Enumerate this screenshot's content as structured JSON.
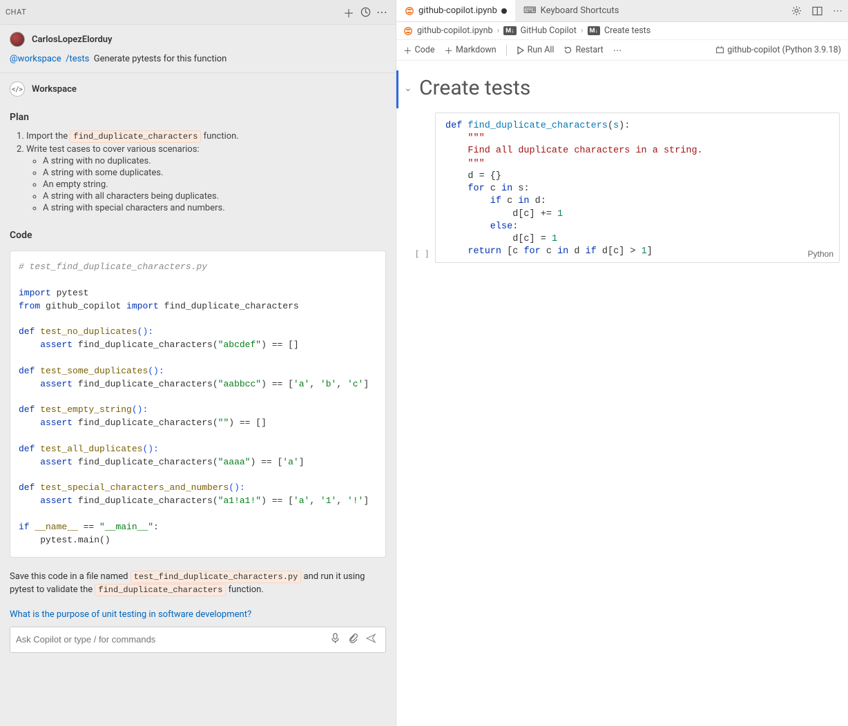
{
  "chat": {
    "header_title": "CHAT",
    "new_icon": "+",
    "history_icon": "history",
    "more_icon": "…",
    "username": "CarlosLopezElorduy",
    "mention": "@workspace",
    "slash": "/tests",
    "request_text": "Generate pytests for this function",
    "workspace_label": "Workspace",
    "plan_heading": "Plan",
    "plan_item1_prefix": "Import the ",
    "plan_item1_code": "find_duplicate_characters",
    "plan_item1_suffix": " function.",
    "plan_item2": "Write test cases to cover various scenarios:",
    "plan_sub": [
      "A string with no duplicates.",
      "A string with some duplicates.",
      "An empty string.",
      "A string with all characters being duplicates.",
      "A string with special characters and numbers."
    ],
    "code_heading": "Code",
    "footer_prefix": "Save this code in a file named ",
    "footer_code1": "test_find_duplicate_characters.py",
    "footer_mid": " and run it using pytest to validate the ",
    "footer_code2": "find_duplicate_characters",
    "footer_suffix": " function.",
    "suggestion": "What is the purpose of unit testing in software development?",
    "input_placeholder": "Ask Copilot or type / for commands"
  },
  "chat_code": {
    "l1": "# test_find_duplicate_characters.py",
    "l3_import": "import",
    "l3_pytest": " pytest",
    "l4_from": "from",
    "l4_mod": " github_copilot ",
    "l4_import": "import",
    "l4_fn": " find_duplicate_characters",
    "t1_def": "def ",
    "t1_name": "test_no_duplicates",
    "t1_paren": "():",
    "t1_assert": "    assert ",
    "t1_call": "find_duplicate_characters(",
    "t1_str": "\"abcdef\"",
    "t1_close": ") == []",
    "t2_name": "test_some_duplicates",
    "t2_str": "\"aabbcc\"",
    "t2_close": ") == [",
    "t2_a": "'a'",
    "t2_c1": ", ",
    "t2_b": "'b'",
    "t2_c2": ", ",
    "t2_c": "'c'",
    "t2_end": "]",
    "t3_name": "test_empty_string",
    "t3_str": "\"\"",
    "t3_close": ") == []",
    "t4_name": "test_all_duplicates",
    "t4_str": "\"aaaa\"",
    "t4_close": ") == [",
    "t4_a": "'a'",
    "t4_end": "]",
    "t5_name": "test_special_characters_and_numbers",
    "t5_str": "\"a1!a1!\"",
    "t5_close": ") == [",
    "t5_a": "'a'",
    "t5_c1": ", ",
    "t5_1": "'1'",
    "t5_c2": ", ",
    "t5_e": "'!'",
    "t5_end": "]",
    "main_if": "if ",
    "main_name": "__name__",
    "main_eq": " == ",
    "main_str": "\"__main__\"",
    "main_colon": ":",
    "main_body": "    pytest.main()"
  },
  "editor": {
    "tab1_label": "github-copilot.ipynb",
    "tab2_label": "Keyboard Shortcuts",
    "breadcrumb_file": "github-copilot.ipynb",
    "breadcrumb_sec1": "GitHub Copilot",
    "breadcrumb_sec2": "Create tests",
    "tb_code": "Code",
    "tb_markdown": "Markdown",
    "tb_runall": "Run All",
    "tb_restart": "Restart",
    "kernel": "github-copilot (Python 3.9.18)",
    "section_title": "Create tests",
    "exec_label": "[ ]",
    "cell_lang": "Python"
  },
  "nb_code": {
    "l1_def": "def ",
    "l1_fn": "find_duplicate_characters",
    "l1_open": "(",
    "l1_param": "s",
    "l1_close": "):",
    "l2": "    \"\"\"",
    "l3": "    Find all duplicate characters in a string.",
    "l4": "    \"\"\"",
    "l5": "    d = {}",
    "l6_for": "    for ",
    "l6_c": "c",
    "l6_in": " in ",
    "l6_s": "s",
    "l6_colon": ":",
    "l7_if": "        if ",
    "l7_c": "c",
    "l7_in": " in ",
    "l7_d": "d",
    "l7_colon": ":",
    "l8_pre": "            d[",
    "l8_c": "c",
    "l8_post": "] += ",
    "l8_num": "1",
    "l9": "        else:",
    "l10_pre": "            d[",
    "l10_c": "c",
    "l10_post": "] = ",
    "l10_num": "1",
    "l11_ret": "    return ",
    "l11_open": "[",
    "l11_c1": "c",
    "l11_for": " for ",
    "l11_c2": "c",
    "l11_in": " in ",
    "l11_d": "d",
    "l11_if": " if ",
    "l11_dc": "d[",
    "l11_c3": "c",
    "l11_dc2": "] > ",
    "l11_num": "1",
    "l11_close": "]"
  }
}
